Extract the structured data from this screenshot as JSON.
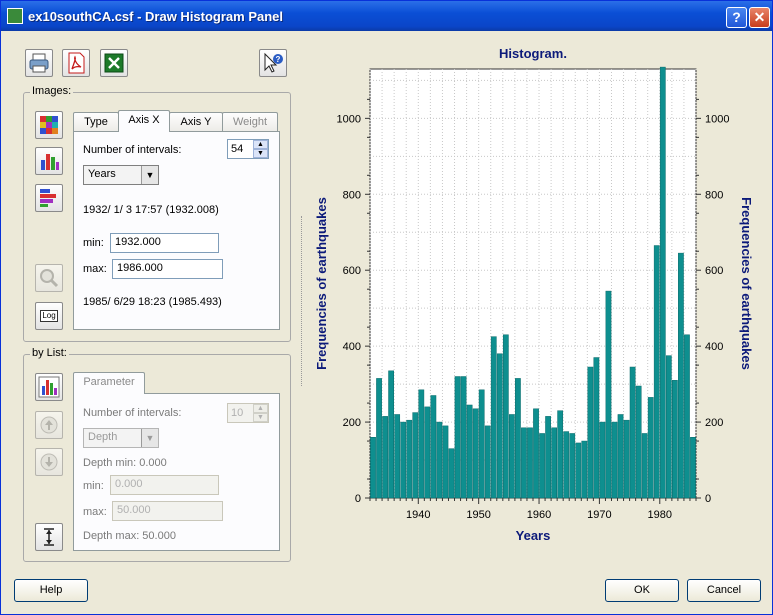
{
  "window": {
    "title": "ex10southCA.csf - Draw Histogram Panel",
    "help_glyph": "?",
    "close_glyph": "✕"
  },
  "toolbar": {
    "icons": [
      "printer-icon",
      "pdf-icon",
      "excel-icon",
      "context-help-icon"
    ]
  },
  "images_group": {
    "label": "Images:",
    "tabs": [
      "Type",
      "Axis X",
      "Axis Y",
      "Weight"
    ],
    "active_tab": "Axis X",
    "intervals_label": "Number of intervals:",
    "intervals_value": "54",
    "unit_select": "Years",
    "start_text": "1932/ 1/ 3 17:57 (1932.008)",
    "min_label": "min:",
    "min_value": "1932.000",
    "max_label": "max:",
    "max_value": "1986.000",
    "end_text": "1985/ 6/29 18:23 (1985.493)",
    "log_label": "Log"
  },
  "list_group": {
    "label": "by List:",
    "tab": "Parameter",
    "intervals_label": "Number of intervals:",
    "intervals_value": "10",
    "param_select": "Depth",
    "depth_min_text": "Depth min: 0.000",
    "min_label": "min:",
    "min_value": "0.000",
    "max_label": "max:",
    "max_value": "50.000",
    "depth_max_text": "Depth max: 50.000"
  },
  "buttons": {
    "help": "Help",
    "ok": "OK",
    "cancel": "Cancel"
  },
  "colors": {
    "bar_fill": "#0e8f8f",
    "bar_edge": "#0a6a6a",
    "label": "#0c1a7a",
    "titlebar": "#0a4fd6"
  },
  "chart_data": {
    "type": "bar",
    "title": "Histogram.",
    "xlabel": "Years",
    "ylabel": "Frequencies of earthquakes",
    "xlim": [
      1932,
      1986
    ],
    "ylim": [
      0,
      1130
    ],
    "xticks": [
      1940,
      1950,
      1960,
      1970,
      1980
    ],
    "yticks": [
      0,
      200,
      400,
      600,
      800,
      1000
    ],
    "grid": true,
    "x": [
      1932,
      1933,
      1934,
      1935,
      1936,
      1937,
      1938,
      1939,
      1940,
      1941,
      1942,
      1943,
      1944,
      1945,
      1946,
      1947,
      1948,
      1949,
      1950,
      1951,
      1952,
      1953,
      1954,
      1955,
      1956,
      1957,
      1958,
      1959,
      1960,
      1961,
      1962,
      1963,
      1964,
      1965,
      1966,
      1967,
      1968,
      1969,
      1970,
      1971,
      1972,
      1973,
      1974,
      1975,
      1976,
      1977,
      1978,
      1979,
      1980,
      1981,
      1982,
      1983,
      1984,
      1985
    ],
    "values": [
      160,
      315,
      215,
      335,
      220,
      200,
      205,
      225,
      285,
      240,
      270,
      200,
      190,
      130,
      320,
      320,
      245,
      235,
      285,
      190,
      425,
      380,
      430,
      220,
      315,
      185,
      185,
      235,
      170,
      215,
      185,
      230,
      175,
      170,
      145,
      150,
      345,
      370,
      200,
      545,
      200,
      220,
      205,
      345,
      295,
      170,
      265,
      665,
      1135,
      375,
      310,
      645,
      430,
      160
    ]
  }
}
